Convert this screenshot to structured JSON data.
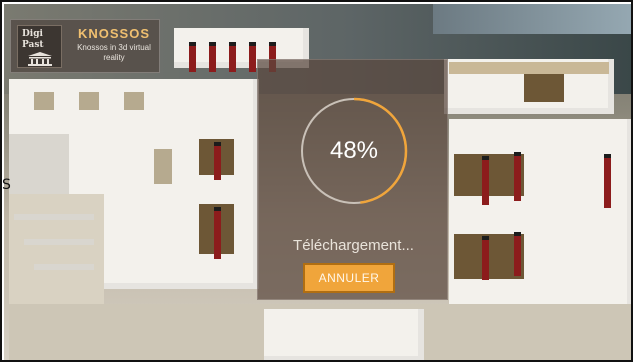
{
  "logo": {
    "mark_line1": "Digi",
    "mark_line2": "Past",
    "title": "KNOSSOS",
    "subtitle": "Knossos in 3d virtual reality"
  },
  "loader": {
    "progress_value": 0.48,
    "percent_text": "48%",
    "status_text": "Téléchargement...",
    "cancel_label": "ANNULER"
  },
  "colors": {
    "accent": "#f0a53b",
    "ring_track": "#c9c1b8",
    "panel_bg": "#5a483e"
  },
  "icons": {
    "logo_mark": "temple-icon"
  }
}
